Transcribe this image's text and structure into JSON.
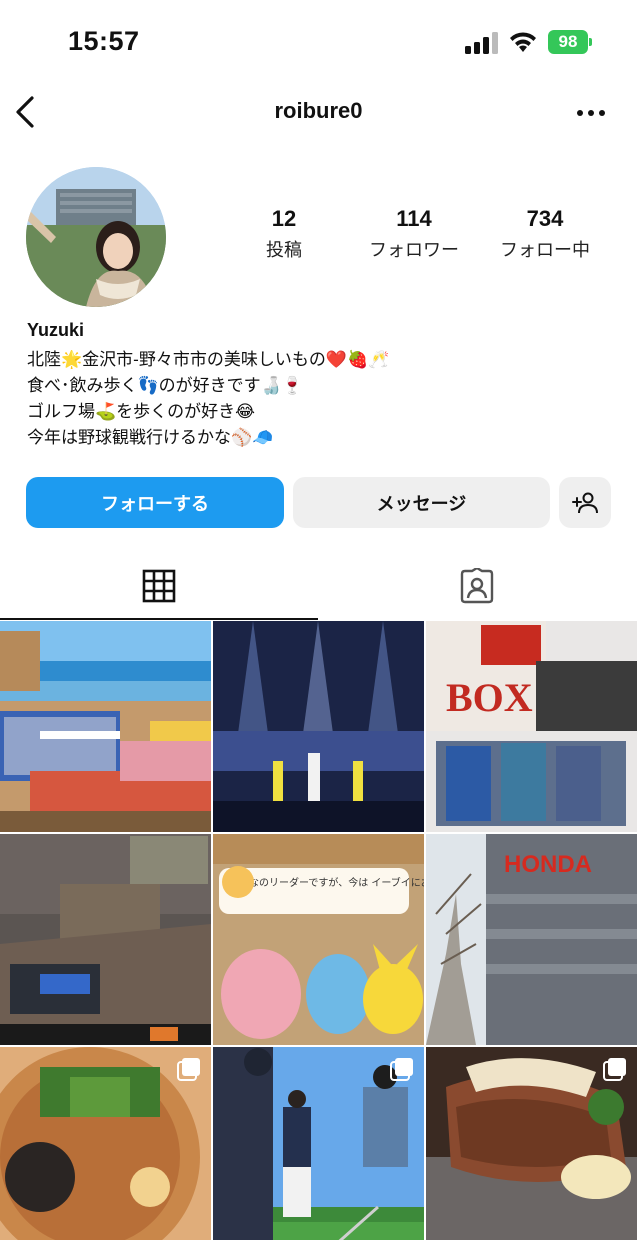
{
  "status": {
    "time": "15:57",
    "battery": "98"
  },
  "header": {
    "username": "roibure0"
  },
  "profile": {
    "stats": [
      {
        "value": "12",
        "label": "投稿"
      },
      {
        "value": "114",
        "label": "フォロワー"
      },
      {
        "value": "734",
        "label": "フォロー中"
      }
    ],
    "display_name": "Yuzuki",
    "bio_lines": [
      "北陸🌟金沢市-野々市市の美味しいもの❤️🍓🥂",
      "食べ･飲み歩く👣のが好きです🍶🍷",
      "ゴルフ場⛳を歩くのが好き😂",
      "今年は野球観戦行けるかな⚾🧢"
    ]
  },
  "actions": {
    "follow_label": "フォローする",
    "message_label": "メッセージ"
  },
  "tabs": [
    {
      "name": "tab-posts-grid",
      "icon": "grid-icon",
      "active": true
    },
    {
      "name": "tab-tagged",
      "icon": "tagged-person-icon",
      "active": false
    }
  ],
  "posts": [
    {
      "name": "post-beach-cafe",
      "overlay_text": ""
    },
    {
      "name": "post-concert-stage",
      "overlay_text": ""
    },
    {
      "name": "post-card-boxes",
      "overlay_text": "BOX"
    },
    {
      "name": "post-game-screenshot",
      "overlay_text": ""
    },
    {
      "name": "post-pokemon-game",
      "overlay_text": "みんなのリーダーですが、今は イーブイにお願いしましょう!"
    },
    {
      "name": "post-honda-building",
      "overlay_text": "HONDA"
    },
    {
      "name": "post-noodle-bowl",
      "overlay_text": "",
      "multi": true
    },
    {
      "name": "post-golf-course",
      "overlay_text": "",
      "multi": true
    },
    {
      "name": "post-steak-plate",
      "overlay_text": "",
      "multi": true
    }
  ],
  "colors": {
    "accent": "#1d9bf0",
    "button_gray": "#efefef",
    "battery": "#34c759"
  }
}
